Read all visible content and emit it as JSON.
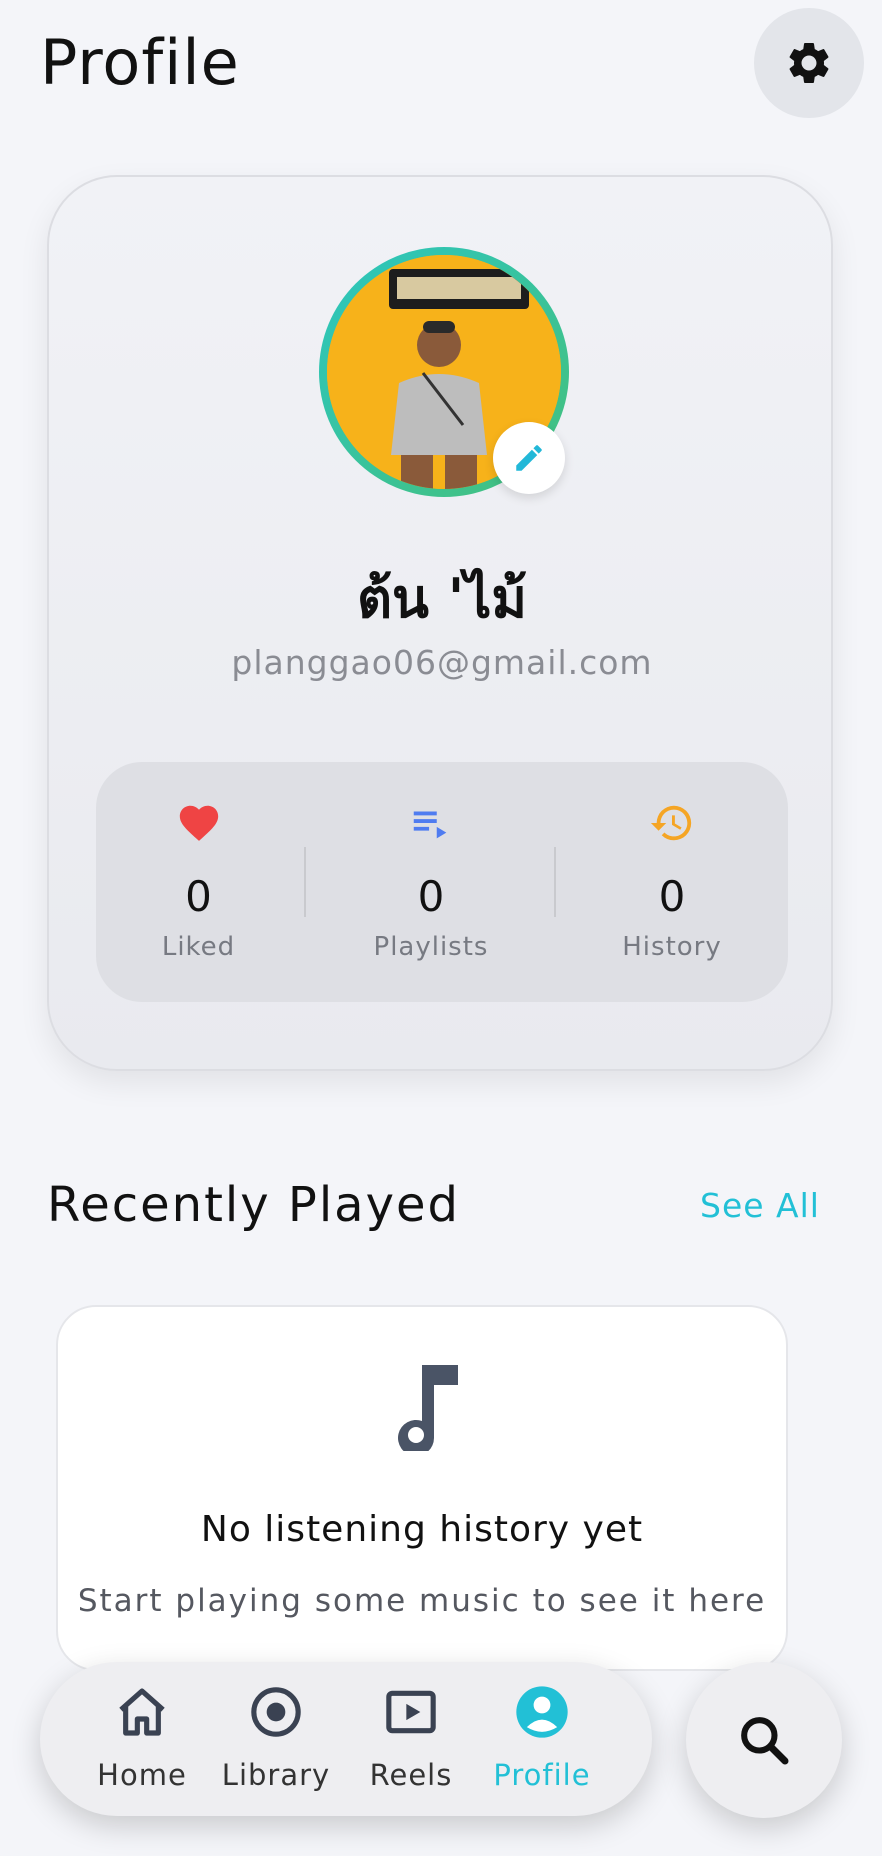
{
  "header": {
    "title": "Profile",
    "settings_icon": "gear-icon"
  },
  "profile": {
    "name": "ต้น 'ไม้",
    "email": "planggao06@gmail.com",
    "edit_icon": "pencil-icon"
  },
  "stats": [
    {
      "icon": "heart-icon",
      "count": "0",
      "label": "Liked",
      "color": "#ef4444"
    },
    {
      "icon": "playlist-icon",
      "count": "0",
      "label": "Playlists",
      "color": "#4f7cf0"
    },
    {
      "icon": "history-icon",
      "count": "0",
      "label": "History",
      "color": "#f5a524"
    }
  ],
  "recent": {
    "title": "Recently Played",
    "see_all": "See All",
    "empty_title": "No listening history yet",
    "empty_subtitle": "Start playing some music to see it here",
    "empty_icon": "music-note-icon"
  },
  "nav": {
    "items": [
      {
        "label": "Home",
        "icon": "home-icon",
        "active": false
      },
      {
        "label": "Library",
        "icon": "library-icon",
        "active": false
      },
      {
        "label": "Reels",
        "icon": "reels-icon",
        "active": false
      },
      {
        "label": "Profile",
        "icon": "profile-icon",
        "active": true
      }
    ],
    "search_icon": "search-icon"
  },
  "colors": {
    "accent": "#22c0d6",
    "background": "#f4f5f9",
    "avatar_ring": "#2cc6c0"
  }
}
